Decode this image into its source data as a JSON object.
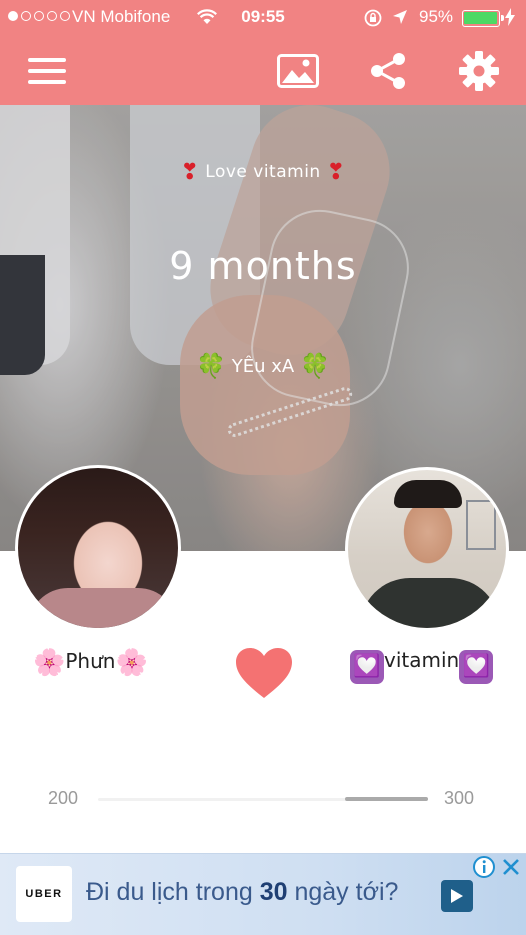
{
  "status_bar": {
    "carrier": "VN Mobifone",
    "time": "09:55",
    "battery_percent": "95%",
    "signal_bars_filled": 1,
    "signal_bars_total": 5
  },
  "app_bar": {
    "icons": [
      "menu-icon",
      "image-icon",
      "share-icon",
      "gear-icon"
    ],
    "color": "#f18383"
  },
  "hero": {
    "title_prefix": "❣",
    "title": "Love vitamin",
    "title_suffix": "❣",
    "duration": "9 months",
    "subtitle_prefix": "🍀",
    "subtitle": "YÊu xA",
    "subtitle_suffix": "🍀"
  },
  "couple": {
    "left_prefix": "🌸",
    "left_name": "Phưn",
    "left_suffix": "🌸",
    "right_prefix": "💟",
    "right_name": "vitamin",
    "right_suffix": "💟",
    "heart_color": "#f47272"
  },
  "slider": {
    "min_label": "200",
    "max_label": "300",
    "value_fraction": 0.75
  },
  "ad": {
    "logo": "UBER",
    "text_before": "Đi du lịch trong ",
    "text_number": "30",
    "text_after": " ngày tới?"
  }
}
